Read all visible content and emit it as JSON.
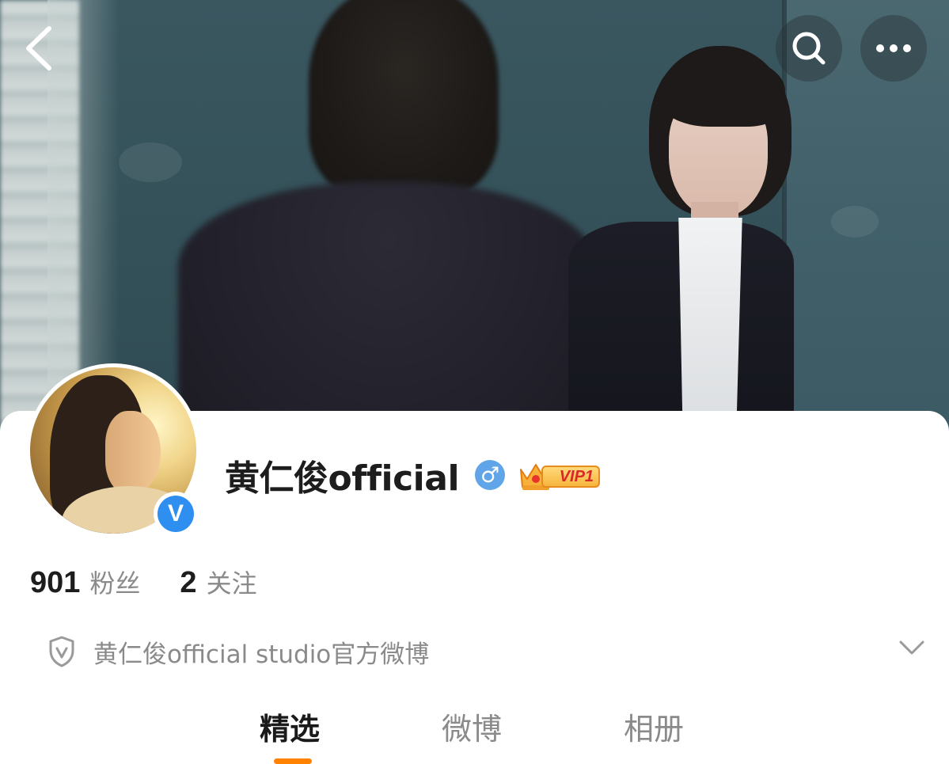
{
  "header": {
    "back_icon": "chevron-left-icon",
    "search_icon": "search-icon",
    "more_icon": "more-horizontal-icon"
  },
  "profile": {
    "username": "黄仁俊official",
    "gender_symbol": "♂",
    "vip_label": "VIP1",
    "verified_symbol": "V",
    "followers_count": "901",
    "followers_label": "粉丝",
    "following_count": "2",
    "following_label": "关注",
    "bio": "黄仁俊official studio官方微博"
  },
  "tabs": [
    {
      "label": "精选",
      "active": true
    },
    {
      "label": "微博",
      "active": false
    },
    {
      "label": "相册",
      "active": false
    }
  ],
  "colors": {
    "accent": "#ff8200",
    "verify_blue": "#2e8ff0",
    "gender_blue": "#5fa5e8",
    "muted_text": "#8a8a8a"
  }
}
